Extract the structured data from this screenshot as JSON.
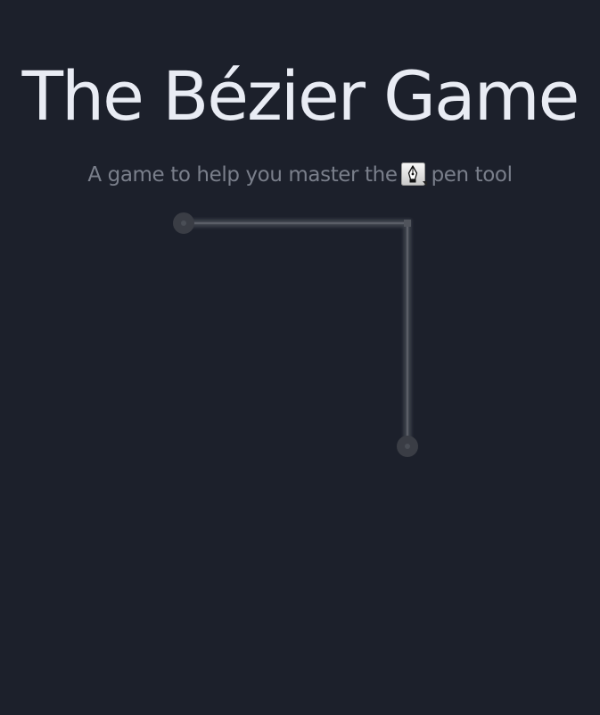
{
  "header": {
    "title": "The Bézier Game",
    "subtitle_before": "A game to help you master the",
    "subtitle_after": "pen tool"
  },
  "icons": {
    "tool_icon": "pen-tool-icon"
  },
  "colors": {
    "background": "#1c202b",
    "title": "#e9ecf4",
    "subtitle": "#7a7f8b",
    "path_stroke": "#3b3f48",
    "path_highlight": "#5a5e67",
    "anchor_fill": "#3a3d45"
  }
}
